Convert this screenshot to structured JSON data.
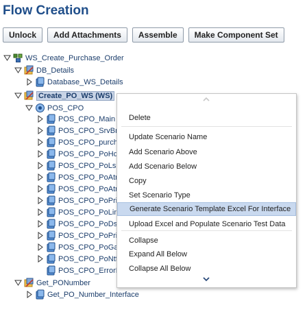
{
  "page": {
    "title": "Flow Creation"
  },
  "toolbar": {
    "unlock": "Unlock",
    "add_attachments": "Add Attachments",
    "assemble": "Assemble",
    "make_component_set": "Make Component Set"
  },
  "tree": {
    "nodes": [
      {
        "label": "WS_Create_Purchase_Order",
        "icon": "flow-icon",
        "toggle": "expanded"
      },
      {
        "label": "DB_Details",
        "icon": "scenario-icon",
        "toggle": "expanded"
      },
      {
        "label": "Database_WS_Details",
        "icon": "component-icon",
        "toggle": "collapsed"
      },
      {
        "label": "Create_PO_WS (WS)",
        "icon": "scenario-icon",
        "toggle": "expanded"
      },
      {
        "label": "POS_CPO",
        "icon": "component-set-icon",
        "toggle": "expanded"
      },
      {
        "label": "POS_CPO_Main",
        "icon": "component-icon",
        "toggle": "collapsed"
      },
      {
        "label": "POS_CPO_SrvBn",
        "icon": "component-icon",
        "toggle": "collapsed"
      },
      {
        "label": "POS_CPO_purch",
        "icon": "component-icon",
        "toggle": "collapsed"
      },
      {
        "label": "POS_CPO_PoHd",
        "icon": "component-icon",
        "toggle": "collapsed"
      },
      {
        "label": "POS_CPO_PoLs",
        "icon": "component-icon",
        "toggle": "collapsed"
      },
      {
        "label": "POS_CPO_PoAtr",
        "icon": "component-icon",
        "toggle": "collapsed"
      },
      {
        "label": "POS_CPO_PoAtr",
        "icon": "component-icon",
        "toggle": "collapsed"
      },
      {
        "label": "POS_CPO_PoPri",
        "icon": "component-icon",
        "toggle": "collapsed"
      },
      {
        "label": "POS_CPO_PoLin",
        "icon": "component-icon",
        "toggle": "collapsed"
      },
      {
        "label": "POS_CPO_PoDst",
        "icon": "component-icon",
        "toggle": "collapsed"
      },
      {
        "label": "POS_CPO_PoPri",
        "icon": "component-icon",
        "toggle": "collapsed"
      },
      {
        "label": "POS_CPO_PoGa",
        "icon": "component-icon",
        "toggle": "collapsed"
      },
      {
        "label": "POS_CPO_PoNtf",
        "icon": "component-icon",
        "toggle": "collapsed"
      },
      {
        "label": "POS_CPO_ErrorMes",
        "icon": "component-icon",
        "toggle": "none"
      },
      {
        "label": "Get_PONumber",
        "icon": "scenario-icon",
        "toggle": "expanded"
      },
      {
        "label": "Get_PO_Number_Interface",
        "icon": "component-icon",
        "toggle": "collapsed"
      }
    ]
  },
  "context_menu": {
    "items": [
      "Delete",
      "Update Scenario Name",
      "Add Scenario Above",
      "Add Scenario Below",
      "Copy",
      "Set Scenario Type",
      "Generate Scenario Template Excel For Interface",
      "Upload Excel and Populate Scenario Test Data",
      "Collapse",
      "Expand All Below",
      "Collapse All Below"
    ],
    "highlighted_index": 6
  },
  "colors": {
    "title": "#1f4e8a",
    "tree_text": "#1b3d6b",
    "menu_highlight": "#c9d9ef"
  }
}
